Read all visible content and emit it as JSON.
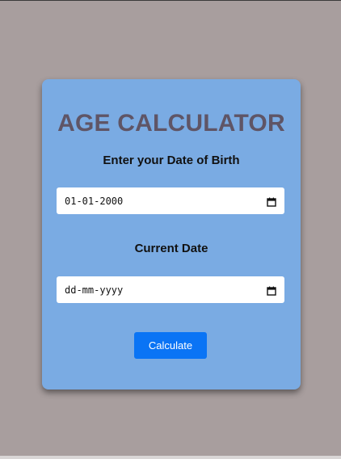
{
  "app": {
    "title": "AGE CALCULATOR"
  },
  "dob": {
    "label": "Enter your Date of Birth",
    "value": "01-01-2000",
    "icon": "calendar-icon"
  },
  "current": {
    "label": "Current Date",
    "placeholder": "dd-mm-yyyy",
    "icon": "calendar-icon"
  },
  "actions": {
    "calculate_label": "Calculate"
  },
  "colors": {
    "page_background": "#a89e9e",
    "card_background": "#7aabe3",
    "title_color": "#5f5566",
    "button_color": "#0a74f5"
  }
}
